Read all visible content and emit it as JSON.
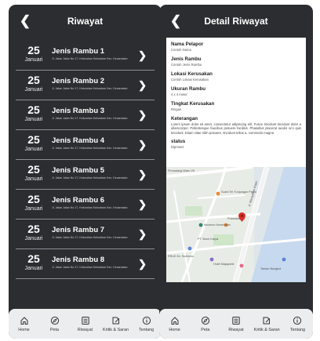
{
  "left_screen": {
    "title": "Riwayat",
    "items": [
      {
        "day": "25",
        "month": "Januari",
        "title": "Jenis Rambu 1",
        "subtitle": "Jl. Jalan Jalan No 17, Kelurahan Kelurahan Kec. Kecamatan"
      },
      {
        "day": "25",
        "month": "Januari",
        "title": "Jenis Rambu 2",
        "subtitle": "Jl. Jalan Jalan No 17, Kelurahan Kelurahan Kec. Kecamatan"
      },
      {
        "day": "25",
        "month": "Januari",
        "title": "Jenis Rambu 3",
        "subtitle": "Jl. Jalan Jalan No 17, Kelurahan Kelurahan Kec. Kecamatan"
      },
      {
        "day": "25",
        "month": "Januari",
        "title": "Jenis Rambu 4",
        "subtitle": "Jl. Jalan Jalan No 17, Kelurahan Kelurahan Kec. Kecamatan"
      },
      {
        "day": "25",
        "month": "Januari",
        "title": "Jenis Rambu 5",
        "subtitle": "Jl. Jalan Jalan No 17, Kelurahan Kelurahan Kec. Kecamatan"
      },
      {
        "day": "25",
        "month": "Januari",
        "title": "Jenis Rambu 6",
        "subtitle": "Jl. Jalan Jalan No 17, Kelurahan Kelurahan Kec. Kecamatan"
      },
      {
        "day": "25",
        "month": "Januari",
        "title": "Jenis Rambu 7",
        "subtitle": "Jl. Jalan Jalan No 17, Kelurahan Kelurahan Kec. Kecamatan"
      },
      {
        "day": "25",
        "month": "Januari",
        "title": "Jenis Rambu 8",
        "subtitle": "Jl. Jalan Jalan No 17, Kelurahan Kelurahan Kec. Kecamatan"
      }
    ]
  },
  "right_screen": {
    "title": "Detail Riwayat",
    "fields": {
      "pelapor_label": "Nama Pelapor",
      "pelapor_value": "Contoh Nama",
      "rambu_label": "Jenis Rambu",
      "rambu_value": "Contoh Jenis Rambu",
      "lokasi_label": "Lokasi Kerusakan",
      "lokasi_value": "Contoh Lokasi Kerusakan",
      "ukuran_label": "Ukuran Rambu",
      "ukuran_value": "4 x 4 meter",
      "tingkat_label": "Tingkat Kerusakan",
      "tingkat_value": "Ringan",
      "keterangan_label": "Keterangan",
      "keterangan_value": "Lorem ipsum dolor sit amet, consectetur adipiscing elit. Fusce tincidunt tincidunt dolor a ullamcorper. Pellentesque faucibus posuere facilisis. Phasellus placerat iaculis orci quis tincidunt. Etiam vitae nibh posuere, tincidunt tellus a, commodo magna",
      "status_label": "status",
      "status_value": "Diproses"
    },
    "map_labels": {
      "street": "Jl. Mangaliran Raya",
      "place1": "Pemadang Waru VII",
      "place2": "Sushi Tei Tunjungan Plaza",
      "place3": "Pucansaman",
      "place4": "Museum Kesehatan",
      "place5": "PT. Bumi Karya",
      "place6": "RSUD Dr. Soetomo",
      "place7": "Hotel Majapahit",
      "place8": "Taman Bungkul"
    }
  },
  "nav": [
    {
      "label": "Home",
      "icon": "home-icon"
    },
    {
      "label": "Peta",
      "icon": "compass-icon"
    },
    {
      "label": "Riwayat",
      "icon": "list-icon"
    },
    {
      "label": "Kritik & Saran",
      "icon": "edit-icon"
    },
    {
      "label": "Tentang",
      "icon": "info-icon"
    }
  ],
  "colors": {
    "bg_dark": "#2b2d31",
    "nav_bg": "#ecedef",
    "pin": "#d93025"
  }
}
